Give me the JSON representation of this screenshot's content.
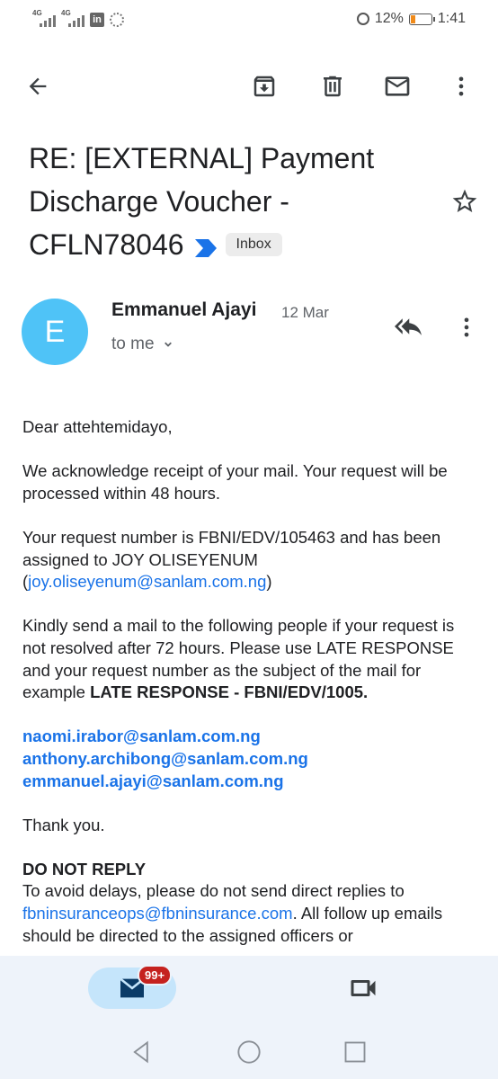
{
  "status_bar": {
    "net1": "4G",
    "net2": "4G",
    "linkedin": "in",
    "battery_pct": "12%",
    "time": "1:41"
  },
  "toolbar": {
    "back": "back-arrow-icon",
    "archive": "archive-icon",
    "delete": "delete-icon",
    "mark_unread": "mail-icon",
    "more": "more-vert-icon"
  },
  "email": {
    "subject": "RE: [EXTERNAL] Payment Discharge Voucher - CFLN78046",
    "label": "Inbox",
    "sender_initial": "E",
    "sender_name": "Emmanuel Ajayi",
    "date": "12 Mar",
    "recipient": "to me",
    "avatar_color": "#4fc3f7"
  },
  "message": {
    "greeting": "Dear attehtemidayo,",
    "p1": "We acknowledge receipt of your mail. Your request will be processed within 48 hours.",
    "p2_text": "Your request number is FBNI/EDV/105463 and has been assigned to JOY OLISEYENUM (",
    "p2_link": "joy.oliseyenum@sanlam.com.ng",
    "p2_end": ")",
    "p3_text": "Kindly send a mail to the following people if your request is not resolved after 72 hours. Please use LATE RESPONSE and your request number as the subject of the mail for example ",
    "p3_bold": "LATE RESPONSE - FBNI/EDV/1005.",
    "contacts": [
      "naomi.irabor@sanlam.com.ng",
      "anthony.archibong@sanlam.com.ng",
      "emmanuel.ajayi@sanlam.com.ng"
    ],
    "thanks": "Thank you.",
    "dnr_title": "DO NOT REPLY",
    "dnr_text": "To avoid delays, please do not send direct replies to ",
    "dnr_link": "fbninsuranceops@fbninsurance.com",
    "dnr_end": ". All follow up emails should be directed to the assigned officers or"
  },
  "bottom_nav": {
    "mail_badge": "99+",
    "accent": "#1a73e8",
    "badge_color": "#c5221f"
  }
}
